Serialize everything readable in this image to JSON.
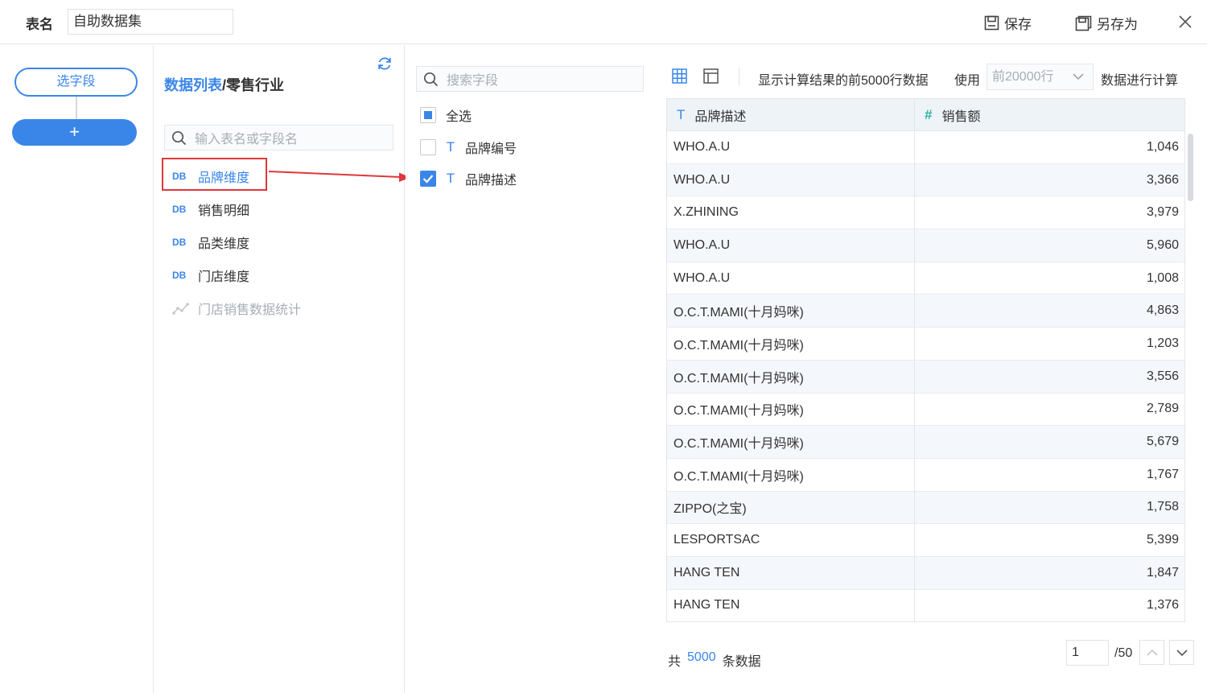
{
  "header": {
    "name_label": "表名",
    "name_value": "自助数据集",
    "save_label": "保存",
    "save_as_label": "另存为"
  },
  "flow": {
    "step_label": "选字段",
    "add_label": "+"
  },
  "data_list": {
    "breadcrumb_root": "数据列表",
    "breadcrumb_sep": "/",
    "breadcrumb_leaf": "零售行业",
    "search_placeholder": "输入表名或字段名",
    "db_tag": "DB",
    "tables": [
      {
        "label": "品牌维度",
        "selected": true
      },
      {
        "label": "销售明细"
      },
      {
        "label": "品类维度"
      },
      {
        "label": "门店维度"
      },
      {
        "label": "门店销售数据统计",
        "disabled": true
      }
    ]
  },
  "fields": {
    "search_placeholder": "搜索字段",
    "select_all_label": "全选",
    "type_icon": "T",
    "items": [
      {
        "label": "品牌编号",
        "checked": false
      },
      {
        "label": "品牌描述",
        "checked": true
      }
    ]
  },
  "preview": {
    "info_text": "显示计算结果的前5000行数据",
    "use_label": "使用",
    "rows_select_value": "前20000行",
    "calc_suffix": "数据进行计算",
    "columns": [
      {
        "type_icon": "T",
        "label": "品牌描述"
      },
      {
        "type_icon": "#",
        "label": "销售额"
      }
    ],
    "rows": [
      [
        "WHO.A.U",
        "1,046"
      ],
      [
        "WHO.A.U",
        "3,366"
      ],
      [
        "X.ZHINING",
        "3,979"
      ],
      [
        "WHO.A.U",
        "5,960"
      ],
      [
        "WHO.A.U",
        "1,008"
      ],
      [
        "O.C.T.MAMI(十月妈咪)",
        "4,863"
      ],
      [
        "O.C.T.MAMI(十月妈咪)",
        "1,203"
      ],
      [
        "O.C.T.MAMI(十月妈咪)",
        "3,556"
      ],
      [
        "O.C.T.MAMI(十月妈咪)",
        "2,789"
      ],
      [
        "O.C.T.MAMI(十月妈咪)",
        "5,679"
      ],
      [
        "O.C.T.MAMI(十月妈咪)",
        "1,767"
      ],
      [
        "ZIPPO(之宝)",
        "1,758"
      ],
      [
        "LESPORTSAC",
        "5,399"
      ],
      [
        "HANG TEN",
        "1,847"
      ],
      [
        "HANG TEN",
        "1,376"
      ]
    ],
    "footer": {
      "count_prefix": "共",
      "count_value": "5000",
      "count_suffix": "条数据",
      "page_value": "1",
      "page_total": "/50"
    }
  },
  "colors": {
    "accent": "#3a86e8",
    "highlight": "#e0373b",
    "number_type": "#2fb3a1"
  }
}
